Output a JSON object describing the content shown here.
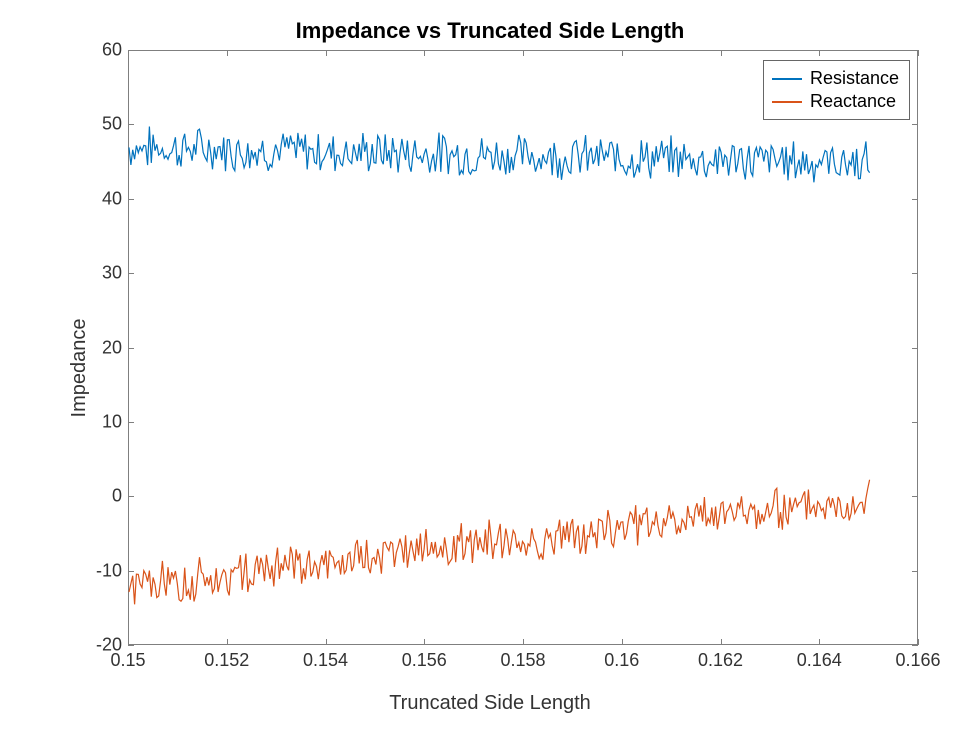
{
  "chart_data": {
    "type": "line",
    "title": "Impedance vs Truncated Side Length",
    "xlabel": "Truncated Side Length",
    "ylabel": "Impedance",
    "xlim": [
      0.15,
      0.166
    ],
    "ylim": [
      -20,
      60
    ],
    "xticks": [
      0.15,
      0.152,
      0.154,
      0.156,
      0.158,
      0.16,
      0.162,
      0.164,
      0.166
    ],
    "yticks": [
      -20,
      -10,
      0,
      10,
      20,
      30,
      40,
      50,
      60
    ],
    "series": [
      {
        "name": "Resistance",
        "color": "#0072bd",
        "x_range": [
          0.15,
          0.165
        ],
        "trend": {
          "start_value": 47,
          "end_value": 45,
          "noise_amplitude": 2.5
        }
      },
      {
        "name": "Reactance",
        "color": "#d95319",
        "x_range": [
          0.15,
          0.165
        ],
        "trend": {
          "start_value": -12,
          "end_value": 0,
          "noise_amplitude": 2.5
        }
      }
    ]
  },
  "legend": {
    "items": [
      "Resistance",
      "Reactance"
    ]
  }
}
